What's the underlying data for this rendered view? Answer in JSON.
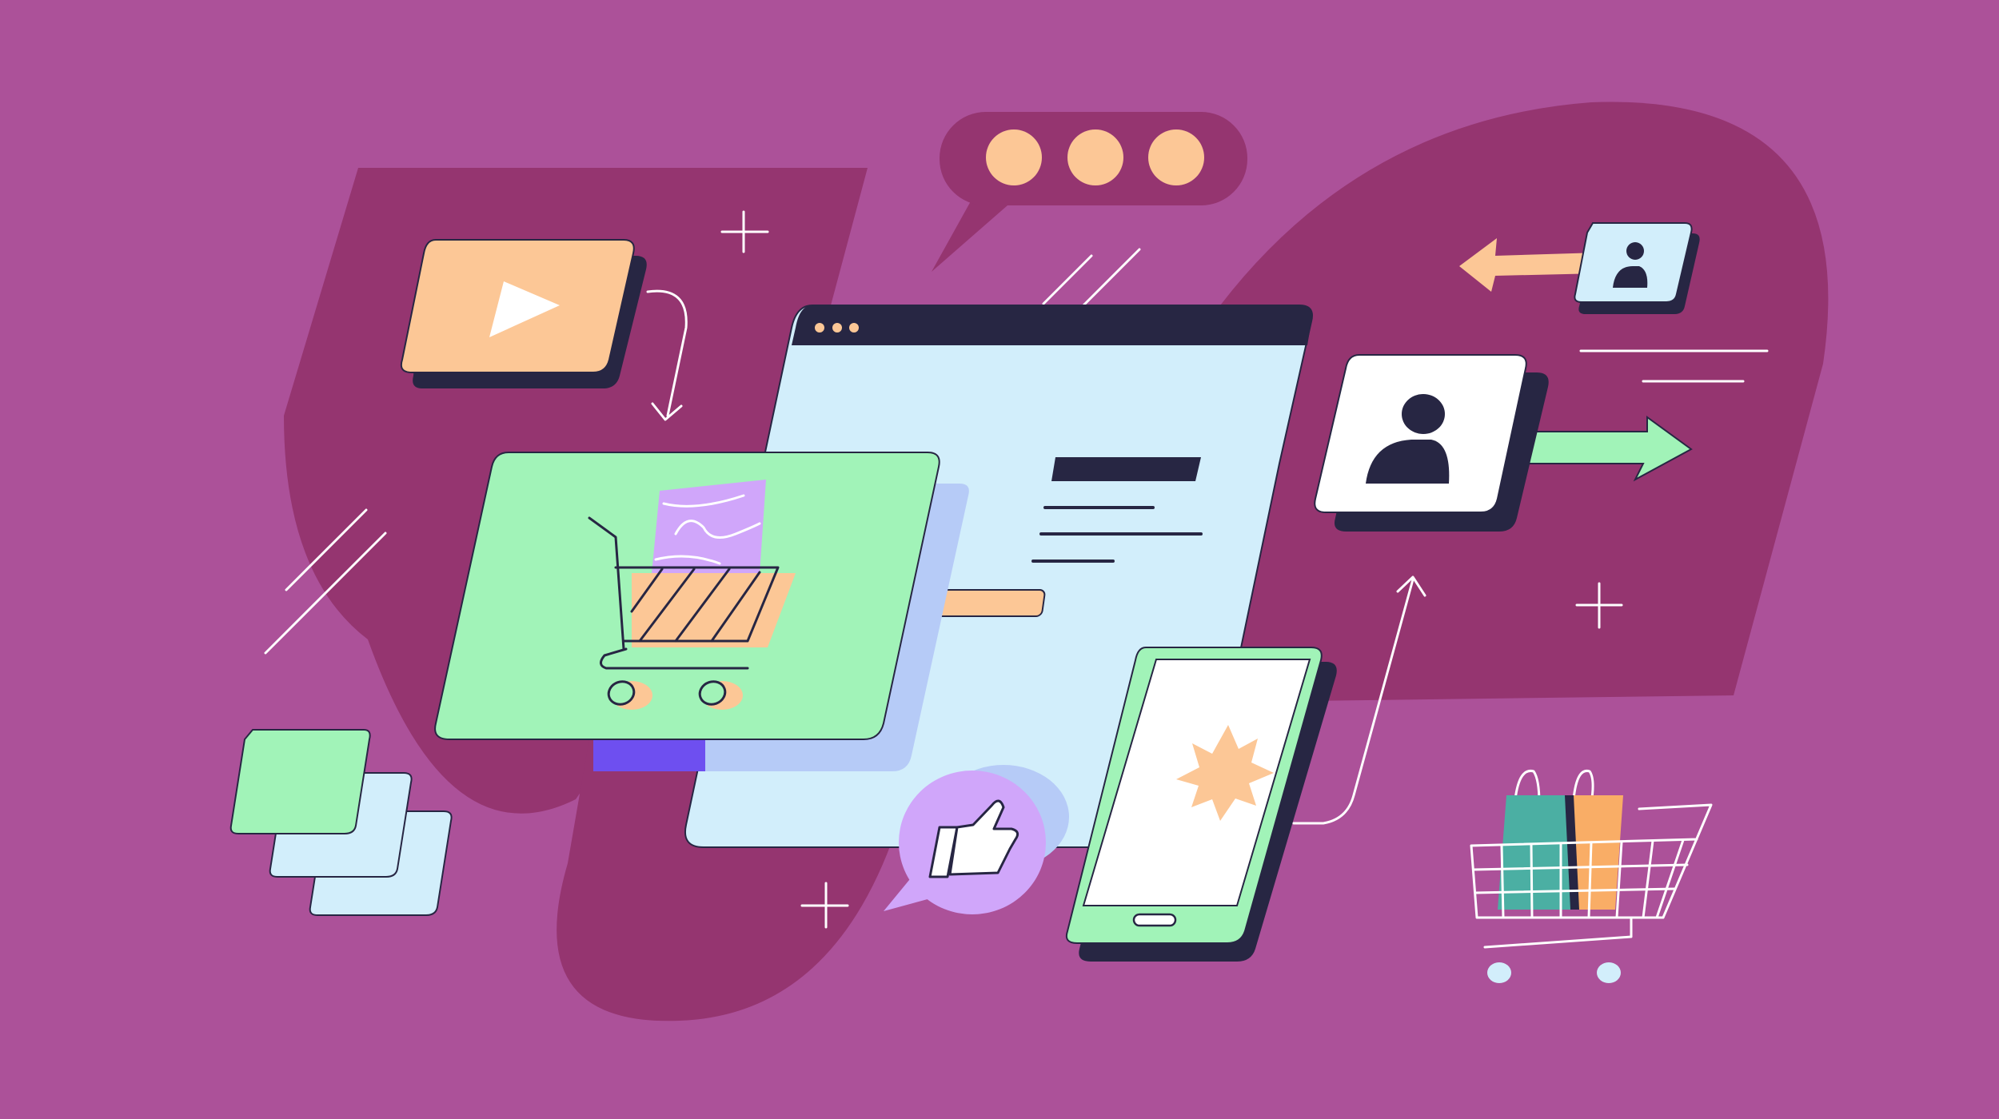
{
  "illustration": {
    "subject": "online-shopping-digital-marketing",
    "colors": {
      "background": "#ac5199",
      "blob": "#953570",
      "navy": "#272643",
      "green": "#a1f3b8",
      "light_blue": "#d2eefb",
      "peach": "#fcc796",
      "lavender": "#d0a6fa",
      "periwinkle": "#b6cbf7",
      "white": "#ffffff",
      "teal": "#4bafa3",
      "orange": "#f9ad66",
      "indigo": "#6e4ff0"
    },
    "elements": [
      "video-player-card",
      "chat-bubble-typing",
      "browser-window",
      "shopping-cart-card",
      "mobile-phone",
      "like-thumbs-up-bubble",
      "user-profile-card",
      "small-user-profile-card",
      "shopping-cart-with-bags",
      "stacked-cards"
    ],
    "icons": [
      "play-icon",
      "cart-icon",
      "user-icon",
      "thumbs-up-icon",
      "starburst-icon",
      "arrow-icon",
      "sparkle-plus-icon"
    ]
  }
}
